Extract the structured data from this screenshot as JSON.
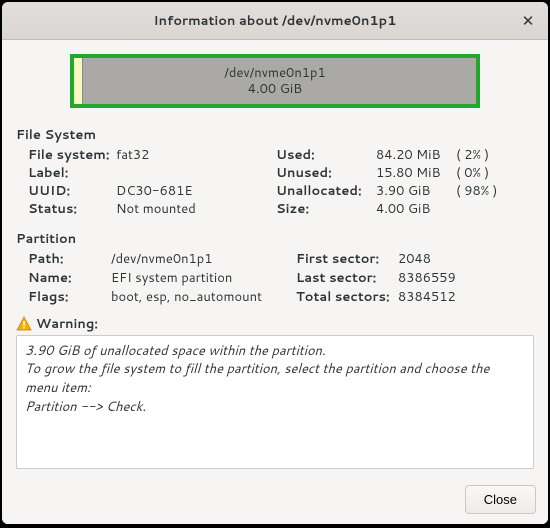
{
  "title": "Information about /dev/nvme0n1p1",
  "usage": {
    "device": "/dev/nvme0n1p1",
    "size": "4.00 GiB",
    "used_percent": 2
  },
  "fs": {
    "heading": "File System",
    "left": {
      "file_system_label": "File system:",
      "file_system": "fat32",
      "label_label": "Label:",
      "label": "",
      "uuid_label": "UUID:",
      "uuid": "DC30-681E",
      "status_label": "Status:",
      "status": "Not mounted"
    },
    "right": {
      "used_label": "Used:",
      "used": "84.20 MiB",
      "used_pct": "( 2% )",
      "unused_label": "Unused:",
      "unused": "15.80 MiB",
      "unused_pct": "( 0% )",
      "unalloc_label": "Unallocated:",
      "unalloc": "3.90 GiB",
      "unalloc_pct": "( 98% )",
      "size_label": "Size:",
      "size": "4.00 GiB"
    }
  },
  "part": {
    "heading": "Partition",
    "left": {
      "path_label": "Path:",
      "path": "/dev/nvme0n1p1",
      "name_label": "Name:",
      "name": "EFI system partition",
      "flags_label": "Flags:",
      "flags": "boot, esp, no_automount"
    },
    "right": {
      "first_label": "First sector:",
      "first": "2048",
      "last_label": "Last sector:",
      "last": "8386559",
      "total_label": "Total sectors:",
      "total": "8384512"
    }
  },
  "warning": {
    "label": "Warning:",
    "line1": "3.90 GiB of unallocated space within the partition.",
    "line2": "To grow the file system to fill the partition, select the partition and choose the menu item:",
    "line3": "Partition --> Check."
  },
  "close_label": "Close"
}
